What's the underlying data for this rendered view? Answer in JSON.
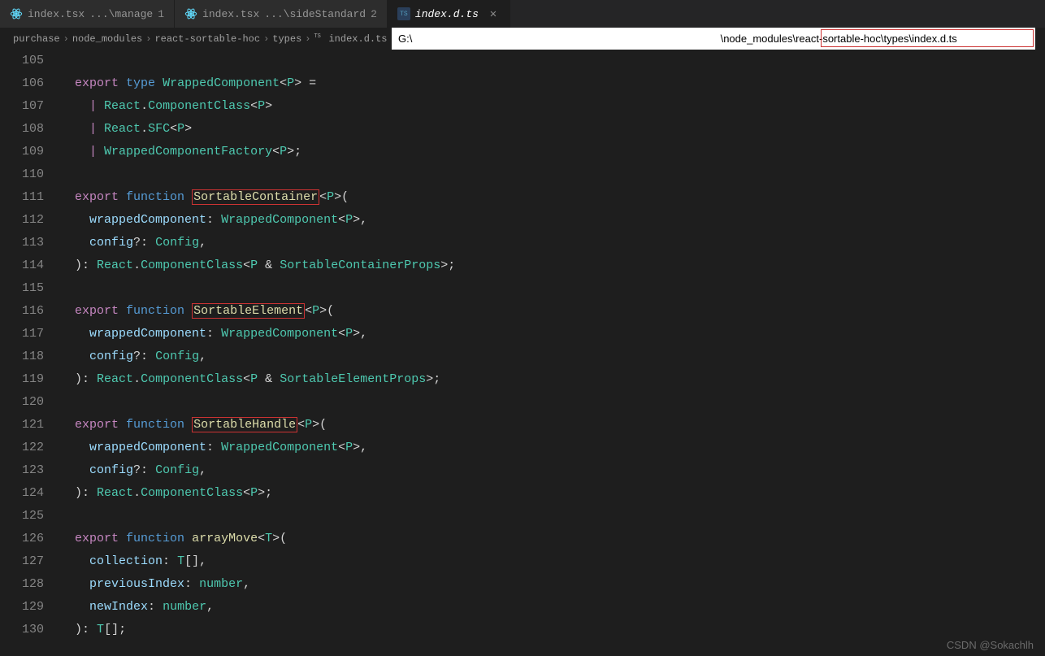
{
  "tabs": [
    {
      "icon": "react",
      "name": "index.tsx",
      "suffix": "...\\manage",
      "badge": "1"
    },
    {
      "icon": "react",
      "name": "index.tsx",
      "suffix": "...\\sideStandard",
      "badge": "2"
    },
    {
      "icon": "ts",
      "name": "index.d.ts",
      "suffix": "",
      "badge": "",
      "active": true,
      "close": true,
      "italic": true
    }
  ],
  "breadcrumb": {
    "crumbs": [
      "purchase",
      "node_modules",
      "react-sortable-hoc",
      "types",
      "index.d.ts",
      "..."
    ],
    "file_icon": "ts"
  },
  "path_input": {
    "value": "G:\\                                                                                                         \\node_modules\\react-sortable-hoc\\types\\index.d.ts",
    "highlight_text": "react-sortable-hoc\\types\\index.d.ts"
  },
  "line_numbers": [
    "105",
    "106",
    "107",
    "108",
    "109",
    "110",
    "111",
    "112",
    "113",
    "114",
    "115",
    "116",
    "117",
    "118",
    "119",
    "120",
    "121",
    "122",
    "123",
    "124",
    "125",
    "126",
    "127",
    "128",
    "129",
    "130"
  ],
  "code_tokens": {
    "export": "export",
    "type_kw": "type",
    "function_kw": "function",
    "WrappedComponent": "WrappedComponent",
    "React": "React",
    "ComponentClass": "ComponentClass",
    "SFC": "SFC",
    "WrappedComponentFactory": "WrappedComponentFactory",
    "SortableContainer": "SortableContainer",
    "SortableElement": "SortableElement",
    "SortableHandle": "SortableHandle",
    "arrayMove": "arrayMove",
    "wrappedComponent": "wrappedComponent",
    "config": "config",
    "Config": "Config",
    "SortableContainerProps": "SortableContainerProps",
    "SortableElementProps": "SortableElementProps",
    "collection": "collection",
    "previousIndex": "previousIndex",
    "newIndex": "newIndex",
    "number": "number",
    "P": "P",
    "T": "T"
  },
  "watermark": "CSDN @Sokachlh"
}
